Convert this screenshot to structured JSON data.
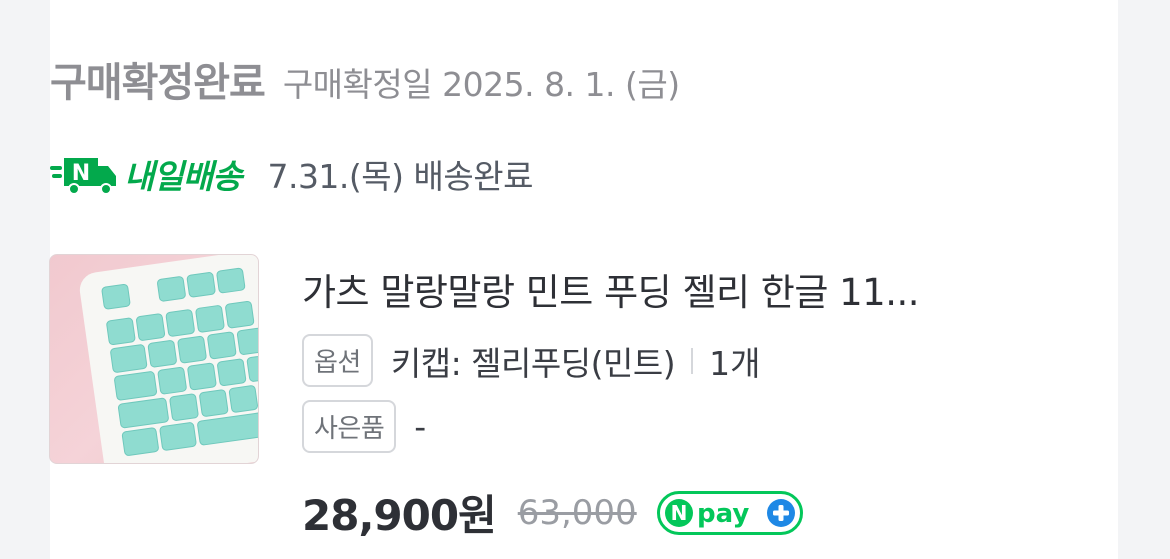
{
  "order_status": {
    "title": "구매확정완료",
    "date_text": "구매확정일 2025. 8. 1. (금)"
  },
  "delivery": {
    "brand": "내일배송",
    "logo_letter": "N",
    "status_text": "7.31.(목) 배송완료",
    "brand_color": "#03a94c"
  },
  "product": {
    "name": "가츠 말랑말랑 민트 푸딩 젤리 한글 11...",
    "option_label": "옵션",
    "option_value": "키캡: 젤리푸딩(민트)",
    "quantity": "1개",
    "gift_label": "사은품",
    "gift_value": "-",
    "price": "28,900원",
    "original_price": "63,000",
    "pay_badge": {
      "letter": "N",
      "text": "pay",
      "plus": "+",
      "color": "#03c75a",
      "plus_color": "#1e88e5"
    }
  }
}
